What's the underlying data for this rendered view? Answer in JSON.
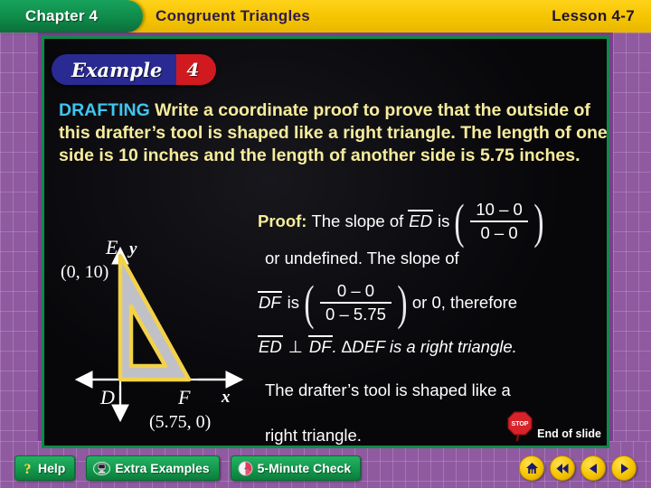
{
  "header": {
    "chapter": "Chapter 4",
    "lesson_title": "Congruent Triangles",
    "lesson_number": "Lesson 4-7"
  },
  "example_banner": {
    "word": "Example",
    "number": "4"
  },
  "problem": {
    "keyword": "DRAFTING",
    "body": "Write a coordinate proof to prove that the outside of this drafter’s tool is shaped like a right triangle. The length of one side is 10 inches and the length of another side is 5.75 inches."
  },
  "proof": {
    "label": "Proof:",
    "line1_pre": "The slope of",
    "line1_seg": "ED",
    "line1_is": "is",
    "frac1_num": "10 – 0",
    "frac1_den": "0 – 0",
    "line2": "or undefined. The slope of",
    "line3_seg": "DF",
    "line3_is": "is",
    "frac2_num": "0 – 0",
    "frac2_den": "0 – 5.75",
    "line3_post": "or 0, therefore",
    "line4_seg1": "ED",
    "line4_perp": "⊥",
    "line4_seg2": "DF",
    "line4_post": ". ∆DEF is a right triangle.",
    "line5": "The drafter’s tool is shaped like a",
    "line6": "right triangle."
  },
  "diagram": {
    "y_axis_label": "y",
    "x_axis_label": "x",
    "point_e_label": "E",
    "point_e_coords": "(0, 10)",
    "point_d_label": "D",
    "point_f_label": "F",
    "point_f_coords": "(5.75, 0)",
    "fill_color": "#c0c0c8",
    "edge_color": "#f2d24a"
  },
  "end_of_slide": {
    "text": "End of slide",
    "icon": "stop-sign-icon"
  },
  "toolbar": {
    "help": "Help",
    "extra_examples": "Extra Examples",
    "five_minute_check": "5-Minute Check",
    "nav": [
      {
        "name": "home-icon"
      },
      {
        "name": "first-slide-icon"
      },
      {
        "name": "previous-slide-icon"
      },
      {
        "name": "next-slide-icon"
      }
    ]
  },
  "colors": {
    "header_gold": "#f5c400",
    "chapter_green": "#0f8a49",
    "border_purple": "#8f5aa0",
    "keyword_cyan": "#3ec6f0",
    "body_yellow": "#f7ec9c"
  }
}
